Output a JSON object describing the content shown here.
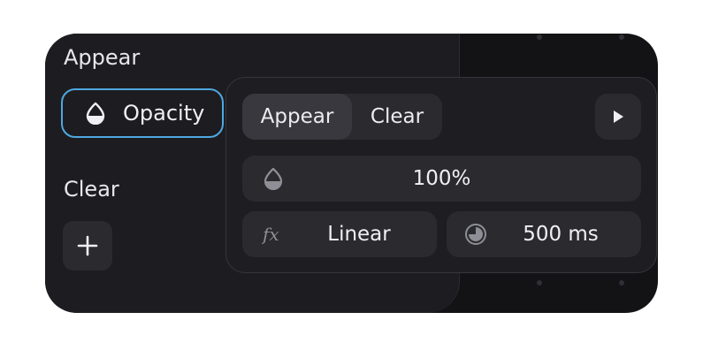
{
  "sections": {
    "appear_label": "Appear",
    "clear_label": "Clear"
  },
  "appear_effect": {
    "label": "Opacity",
    "icon": "droplet-icon"
  },
  "add_button": {
    "icon": "plus-icon"
  },
  "popup": {
    "tabs": [
      {
        "label": "Appear",
        "active": true
      },
      {
        "label": "Clear",
        "active": false
      }
    ],
    "play_icon": "play-icon",
    "opacity_value": "100%",
    "easing_value": "Linear",
    "easing_icon": "fx-icon",
    "duration_value": "500 ms",
    "duration_icon": "timer-icon"
  },
  "colors": {
    "accent": "#4fa8e0",
    "card_bg": "#131316",
    "panel_bg": "#1d1d21",
    "control_bg": "#2a2a2f"
  }
}
